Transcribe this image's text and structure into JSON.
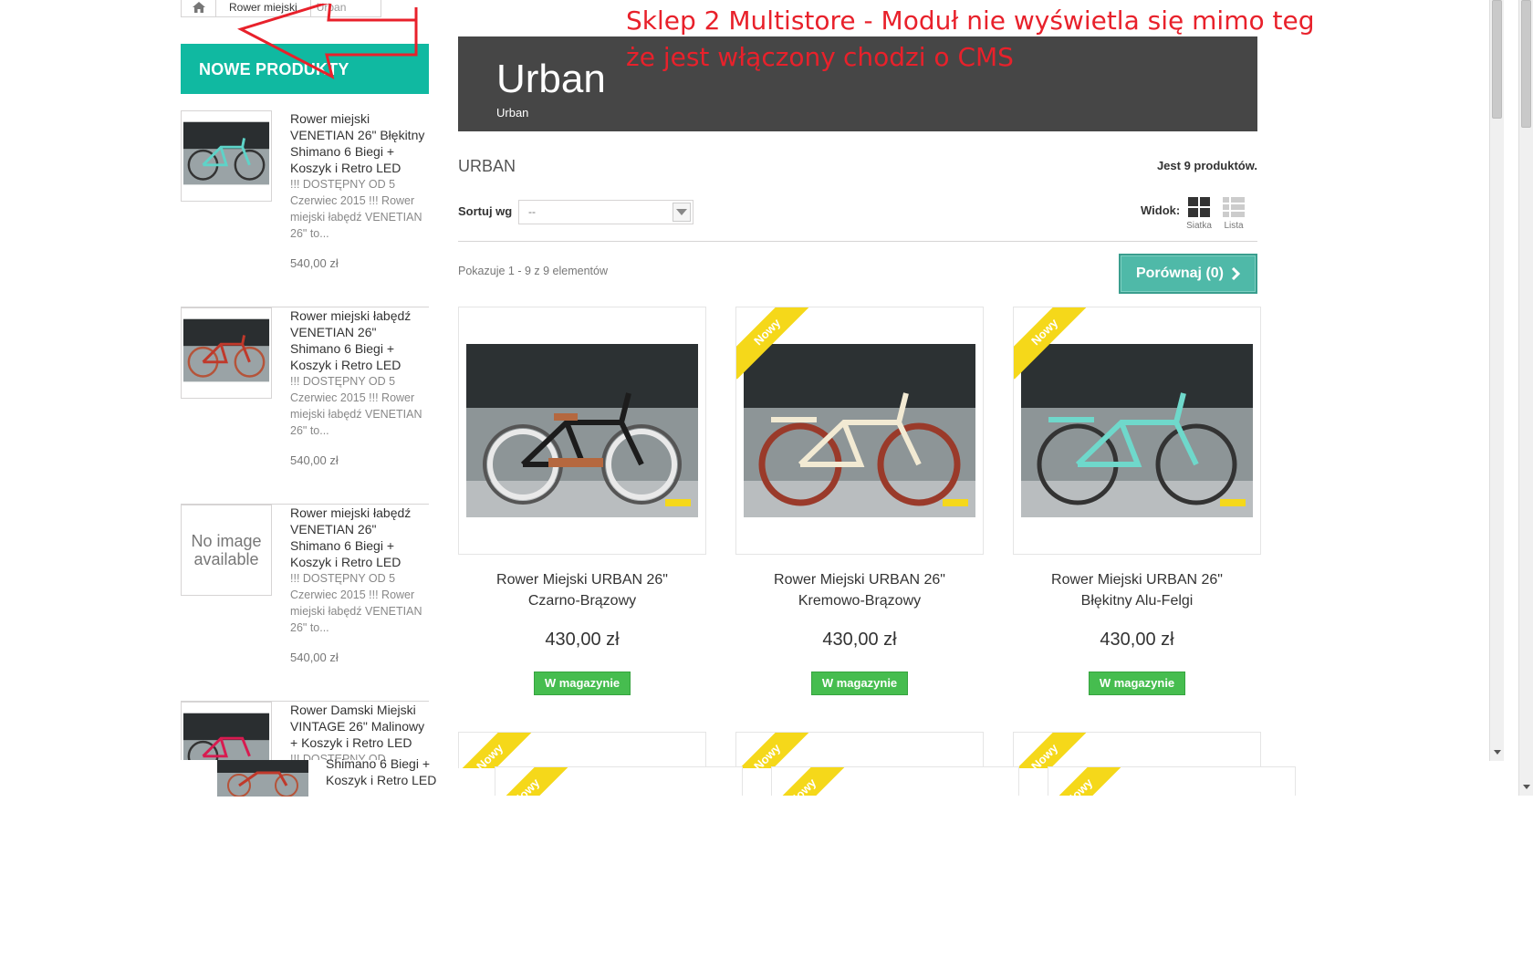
{
  "breadcrumb": {
    "home_icon": "home-icon",
    "items": [
      "Rower miejski",
      "Urban"
    ]
  },
  "new_products": {
    "title": "NOWE PRODUKTY",
    "items": [
      {
        "name": "Rower miejski VENETIAN 26\" Błękitny Shimano 6 Biegi + Koszyk i Retro LED",
        "desc": "!!! DOSTĘPNY OD 5 Czerwiec 2015 !!! Rower miejski łabędź VENETIAN 26\" to...",
        "price": "540,00 zł",
        "image": "bike-teal"
      },
      {
        "name": "Rower miejski łabędź VENETIAN 26\" Shimano 6 Biegi + Koszyk i Retro LED",
        "desc": "!!! DOSTĘPNY OD 5 Czerwiec 2015 !!! Rower miejski łabędź VENETIAN 26\" to...",
        "price": "540,00 zł",
        "image": "bike-red"
      },
      {
        "name": "Rower miejski łabędź VENETIAN 26\" Shimano 6 Biegi + Koszyk i Retro LED",
        "desc": "!!! DOSTĘPNY OD 5 Czerwiec 2015 !!! Rower miejski łabędź VENETIAN 26\" to...",
        "price": "540,00 zł",
        "no_image": "No image available"
      },
      {
        "name": "Rower Damski Miejski VINTAGE 26\" Malinowy + Koszyk i Retro LED",
        "desc": "!!! DOSTĘPNY OD",
        "image": "bike-pink"
      }
    ],
    "overlap_text": "Shimano 6 Biegi + Koszyk i Retro LED"
  },
  "category": {
    "banner_title": "Urban",
    "banner_subtitle": "Urban",
    "heading": "URBAN",
    "count": "Jest 9 produktów."
  },
  "toolbar": {
    "sort_label": "Sortuj wg",
    "sort_value": "--",
    "view_label": "Widok:",
    "grid_label": "Siatka",
    "list_label": "Lista",
    "showing": "Pokazuje 1 - 9 z 9 elementów",
    "compare": "Porównaj (0)"
  },
  "products": [
    {
      "name_line1": "Rower Miejski URBAN 26\"",
      "name_line2": "Czarno-Brązowy",
      "price": "430,00 zł",
      "stock": "W magazynie",
      "badge": ""
    },
    {
      "name_line1": "Rower Miejski URBAN 26\"",
      "name_line2": "Kremowo-Brązowy",
      "price": "430,00 zł",
      "stock": "W magazynie",
      "badge": "Nowy"
    },
    {
      "name_line1": "Rower Miejski URBAN 26\"",
      "name_line2": "Błękitny Alu-Felgi",
      "price": "430,00 zł",
      "stock": "W magazynie",
      "badge": "Nowy"
    }
  ],
  "partial_badge": "Nowy",
  "annotation": {
    "line1": "Sklep 2 Multistore - Moduł nie wyświetla się mimo teg",
    "line2a": "że jest włączony",
    "line2b": "chodzi o CMS",
    "color": "#e8212b"
  },
  "colors": {
    "accent": "#10b9a1",
    "banner": "#464646",
    "stock_green": "#46bd4f",
    "ribbon": "#f5d81a"
  }
}
